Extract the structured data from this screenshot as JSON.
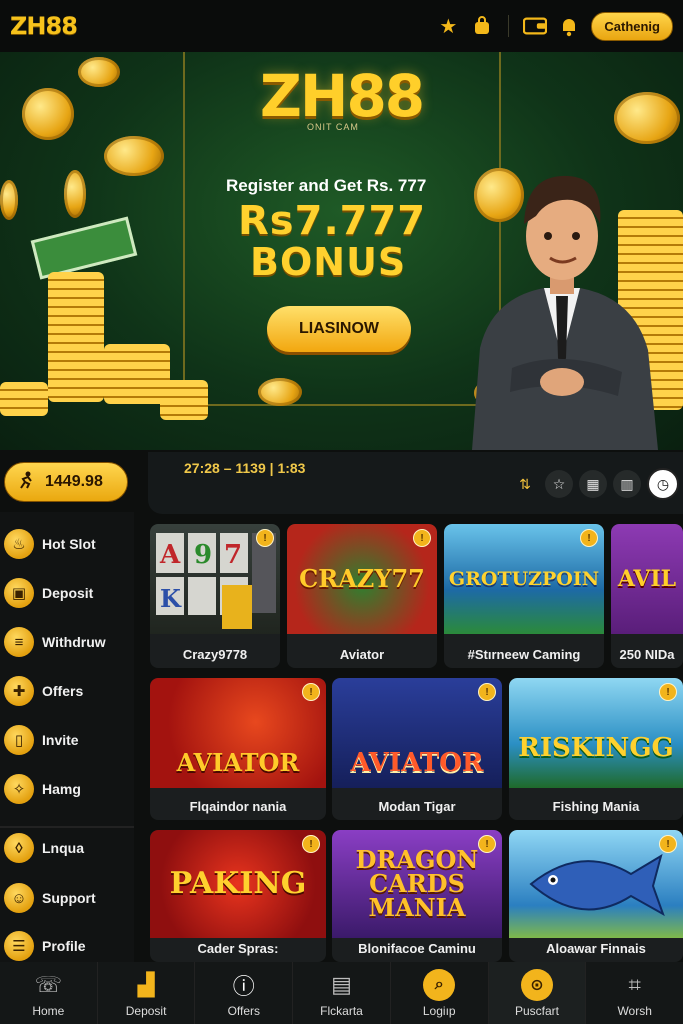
{
  "header": {
    "logo": "ZH88",
    "cash_button": "Cathenig",
    "icons": [
      "star-icon",
      "bag-icon",
      "wallet-icon",
      "bell-icon"
    ]
  },
  "banner": {
    "logo": "ZH88",
    "logo_sub": "ONIT CAM",
    "register_text": "Register and Get Rs. 777",
    "amount": "Rs7.777",
    "bonus": "BONUS",
    "cta": "LIASINOW"
  },
  "balance": {
    "value": "1449.98",
    "icon": "runner-icon"
  },
  "info_bar": {
    "text": "27:28 – 1139 | 1:83"
  },
  "sidebar": {
    "items": [
      {
        "label": "Hot Slot",
        "icon": "flame-icon"
      },
      {
        "label": "Deposit",
        "icon": "deposit-icon"
      },
      {
        "label": "Withdruw",
        "icon": "withdraw-icon"
      },
      {
        "label": "Offers",
        "icon": "offers-icon"
      },
      {
        "label": "Invite",
        "icon": "invite-icon"
      },
      {
        "label": "Hamg",
        "icon": "hang-icon"
      },
      {
        "label": "Lnqua",
        "icon": "language-icon"
      },
      {
        "label": "Support",
        "icon": "support-icon"
      },
      {
        "label": "Profile",
        "icon": "profile-icon"
      }
    ]
  },
  "games": [
    {
      "thumb": "",
      "caption": "Crazy9778",
      "bg": "#2a2f2f"
    },
    {
      "thumb": "CRAZY77",
      "caption": "Aviator",
      "bg": "#b5261b"
    },
    {
      "thumb": "GROTUZPOIN",
      "caption": "#Stırneew Caming",
      "bg": "#2f8fc4"
    },
    {
      "thumb": "AVIL",
      "caption": "250 NIDa",
      "bg": "#7b2ba1"
    },
    {
      "thumb": "AVIATOR",
      "caption": "Flqaindor nania",
      "bg": "#c81e1e"
    },
    {
      "thumb": "AVIATOR",
      "caption": "Modan Tigar",
      "bg": "#1e2f80"
    },
    {
      "thumb": "RISKINGG",
      "caption": "Fishing Mania",
      "bg": "#3aa9d6"
    },
    {
      "thumb": "PAKING",
      "caption": "Cader Spras:",
      "bg": "#b8161a"
    },
    {
      "thumb": "DRAGON CARDS MANIA",
      "caption": "Blonifacoe Caminu",
      "bg": "#5b2a8c"
    },
    {
      "thumb": "",
      "caption": "Aloawar Finnais",
      "bg": "#2c7fc0"
    }
  ],
  "nav": [
    {
      "label": "Home",
      "icon": "home-icon"
    },
    {
      "label": "Deposit",
      "icon": "deposit-icon"
    },
    {
      "label": "Offers",
      "icon": "info-icon"
    },
    {
      "label": "Flckarta",
      "icon": "store-icon"
    },
    {
      "label": "Logiıp",
      "icon": "login-icon"
    },
    {
      "label": "Puscfart",
      "icon": "pin-icon"
    },
    {
      "label": "Worsh",
      "icon": "grid-icon"
    }
  ],
  "colors": {
    "accent": "#f2b41c",
    "banner": "#124020",
    "bg": "#0d0f0e"
  }
}
